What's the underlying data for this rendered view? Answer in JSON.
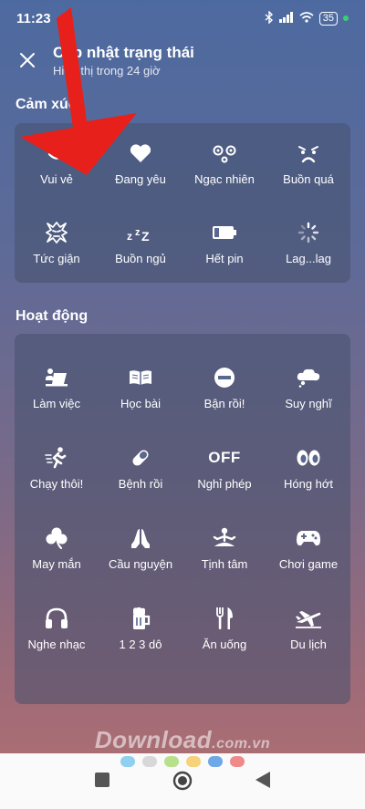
{
  "status_bar": {
    "time": "11:23",
    "dots": "···",
    "battery": "35"
  },
  "header": {
    "title": "Cập nhật trạng thái",
    "subtitle": "Hiển thị trong 24 giờ"
  },
  "emotions": {
    "title": "Cảm xúc",
    "items": [
      {
        "label": "Vui vẻ",
        "icon": "smile-icon"
      },
      {
        "label": "Đang yêu",
        "icon": "heart-icon"
      },
      {
        "label": "Ngạc nhiên",
        "icon": "surprised-icon"
      },
      {
        "label": "Buồn quá",
        "icon": "sad-icon"
      },
      {
        "label": "Tức giận",
        "icon": "angry-icon"
      },
      {
        "label": "Buồn ngủ",
        "icon": "sleepy-icon"
      },
      {
        "label": "Hết pin",
        "icon": "battery-low-icon"
      },
      {
        "label": "Lag...lag",
        "icon": "loading-icon"
      }
    ]
  },
  "activities": {
    "title": "Hoạt động",
    "items": [
      {
        "label": "Làm việc",
        "icon": "laptop-worker-icon"
      },
      {
        "label": "Học bài",
        "icon": "book-icon"
      },
      {
        "label": "Bận rồi!",
        "icon": "busy-icon"
      },
      {
        "label": "Suy nghĩ",
        "icon": "thought-cloud-icon"
      },
      {
        "label": "Chạy thôi!",
        "icon": "running-icon"
      },
      {
        "label": "Bệnh rồi",
        "icon": "pill-icon"
      },
      {
        "label": "Nghỉ phép",
        "icon": "off-icon",
        "text": "OFF"
      },
      {
        "label": "Hóng hớt",
        "icon": "eyes-icon"
      },
      {
        "label": "May mắn",
        "icon": "clover-icon"
      },
      {
        "label": "Cầu nguyện",
        "icon": "pray-icon"
      },
      {
        "label": "Tịnh tâm",
        "icon": "meditation-icon"
      },
      {
        "label": "Chơi game",
        "icon": "gamepad-icon"
      },
      {
        "label": "Nghe nhạc",
        "icon": "headphones-icon"
      },
      {
        "label": "1 2 3 dô",
        "icon": "beer-icon"
      },
      {
        "label": "Ăn uống",
        "icon": "fork-knife-icon"
      },
      {
        "label": "Du lịch",
        "icon": "airplane-icon"
      }
    ]
  },
  "watermark": {
    "main": "Download",
    "suffix": ".com.vn"
  },
  "nav_dots": [
    "#8fd0f0",
    "#d8d8d8",
    "#b8e08a",
    "#f6d27a",
    "#6fa8e8",
    "#f08a8a"
  ],
  "arrow_color": "#e8201c"
}
